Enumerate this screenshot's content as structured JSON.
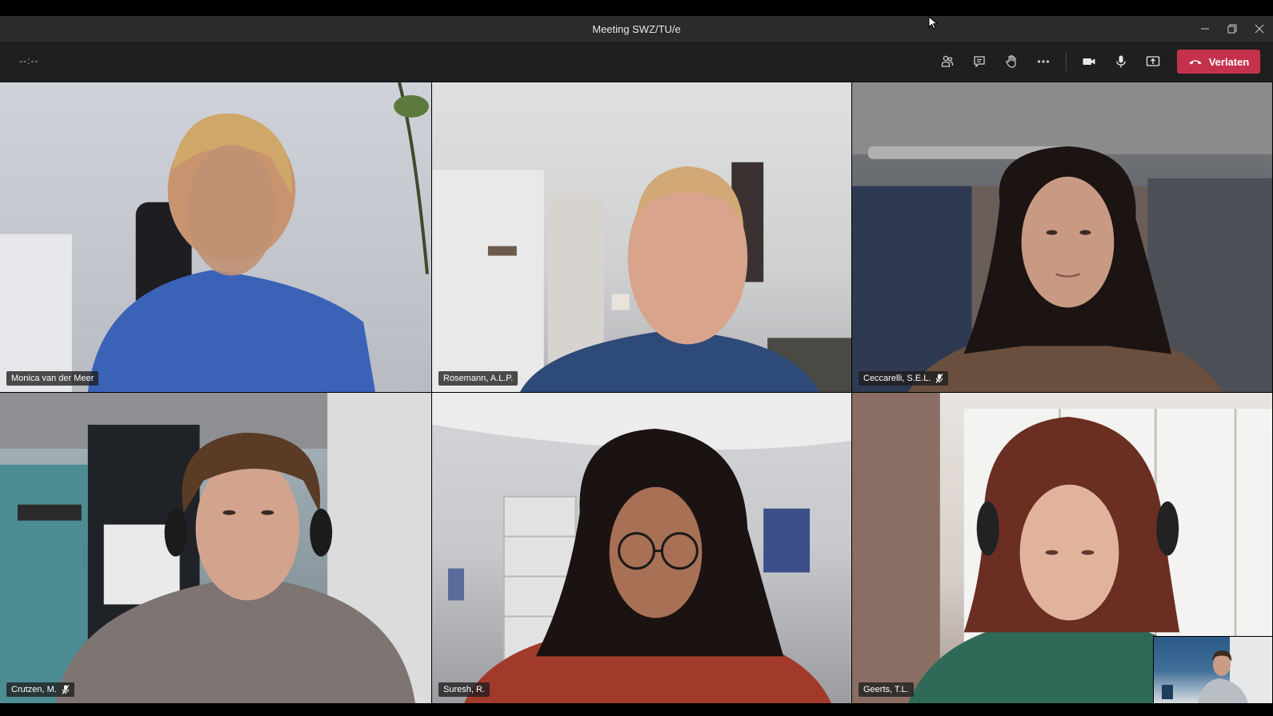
{
  "window": {
    "title": "Meeting SWZ/TU/e"
  },
  "toolbar": {
    "timer": "--:--",
    "leave_label": "Verlaten",
    "icons": [
      "participants-icon",
      "chat-icon",
      "raise-hand-icon",
      "more-options-icon",
      "camera-icon",
      "microphone-icon",
      "share-screen-icon",
      "hang-up-icon"
    ]
  },
  "colors": {
    "leave_button": "#c4314b",
    "toolbar_bg": "#1f1f1f",
    "titlebar_bg": "#2b2b2b"
  },
  "participants": [
    {
      "name": "Monica van der Meer",
      "muted": false
    },
    {
      "name": "Rosemann, A.L.P.",
      "muted": false
    },
    {
      "name": "Ceccarelli, S.E.L.",
      "muted": true
    },
    {
      "name": "Crutzen, M.",
      "muted": true
    },
    {
      "name": "Suresh, R.",
      "muted": false
    },
    {
      "name": "Geerts, T.L.",
      "muted": false
    }
  ]
}
